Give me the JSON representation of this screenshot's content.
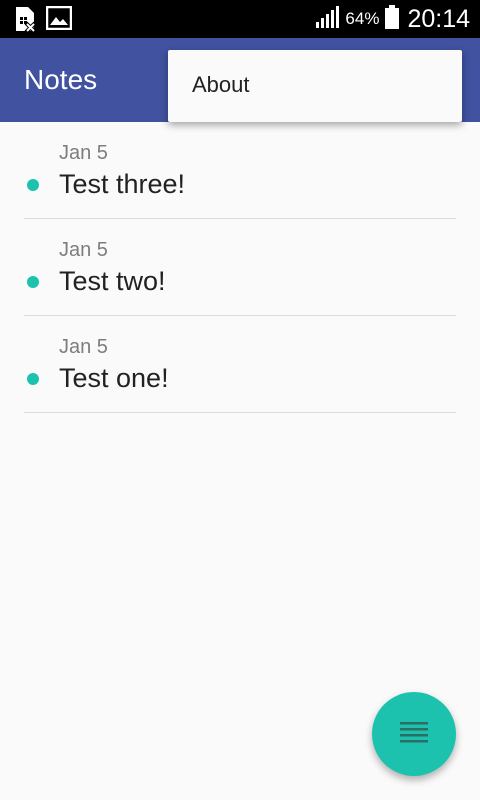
{
  "status_bar": {
    "icons": [
      "sim-card-blocked-icon",
      "image-icon",
      "signal-icon",
      "battery-icon"
    ],
    "battery_percent": "64%",
    "time": "20:14"
  },
  "app_bar": {
    "title": "Notes",
    "color": "#4052a0"
  },
  "overflow_menu": {
    "items": [
      {
        "label": "About"
      }
    ]
  },
  "notes": [
    {
      "date": "Jan 5",
      "title": "Test three!"
    },
    {
      "date": "Jan 5",
      "title": "Test two!"
    },
    {
      "date": "Jan 5",
      "title": "Test one!"
    }
  ],
  "accent_color": "#1dc2ae",
  "fab": {
    "icon": "list-icon"
  }
}
